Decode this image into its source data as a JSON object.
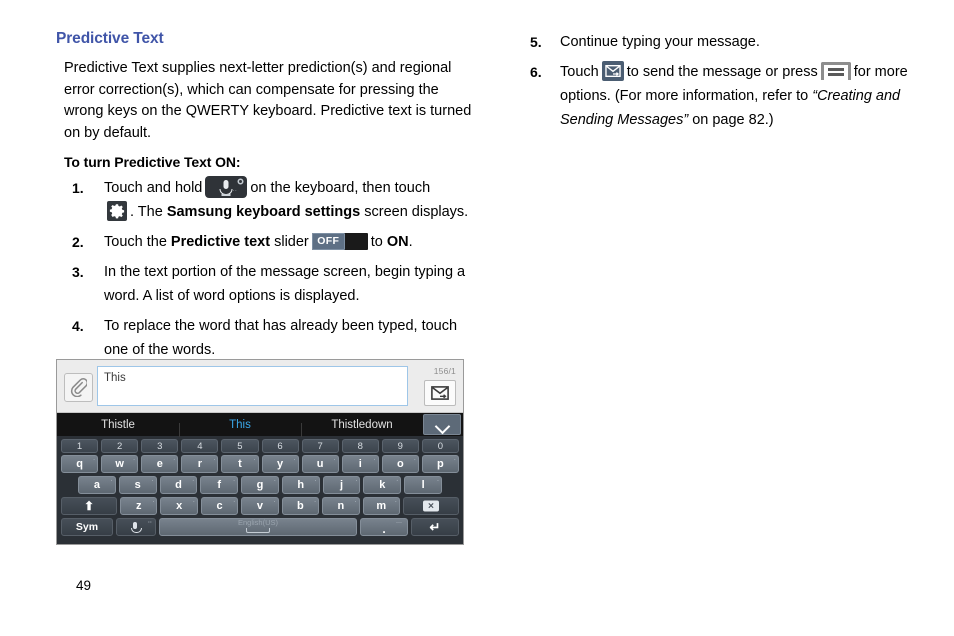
{
  "document": {
    "page_number": "49"
  },
  "left_column": {
    "section_title": "Predictive Text",
    "intro_paragraph": "Predictive Text supplies next-letter prediction(s) and regional error correction(s), which can compensate for pressing the wrong keys on the QWERTY keyboard. Predictive text is turned on by default.",
    "lead_in": "To turn Predictive Text ON:",
    "steps": [
      {
        "num": "1.",
        "part1": "Touch and hold",
        "icon1": "microphone-key-icon",
        "part2": "on the keyboard, then touch",
        "icon2": "gear-icon",
        "part3": ". The",
        "bold1": "Samsung keyboard settings",
        "part4": "screen displays."
      },
      {
        "num": "2.",
        "part1": "Touch the",
        "bold1": "Predictive text",
        "part2": "slider",
        "icon1": "off-slider-toggle",
        "slider_label": "OFF",
        "part3": "to",
        "bold2": "ON",
        "part4": "."
      },
      {
        "num": "3.",
        "text": "In the text portion of the message screen, begin typing a word. A list of word options is displayed."
      },
      {
        "num": "4.",
        "text": "To replace the word that has already been typed, touch one of the words."
      }
    ]
  },
  "right_column": {
    "steps": [
      {
        "num": "5.",
        "text": "Continue typing your message."
      },
      {
        "num": "6.",
        "part1": "Touch",
        "icon1": "send-message-icon",
        "part2": "to send the message or press",
        "icon2": "menu-key-icon",
        "part3": "for more options. (For more information, refer to",
        "italic_ref": "“Creating and Sending Messages”",
        "part4": "on page 82.)"
      }
    ]
  },
  "screenshot": {
    "compose": {
      "attach_icon": "paperclip-icon",
      "message_text": "This",
      "char_counter": "156/1",
      "send_icon": "send-envelope-icon"
    },
    "suggestions": {
      "items": [
        {
          "label": "Thistle",
          "active": false
        },
        {
          "label": "This",
          "active": true
        },
        {
          "label": "Thistledown",
          "active": false
        }
      ],
      "expand_icon": "chevron-down-icon"
    },
    "keyboard": {
      "number_row": [
        "1",
        "2",
        "3",
        "4",
        "5",
        "6",
        "7",
        "8",
        "9",
        "0"
      ],
      "row1": [
        {
          "key": "q",
          "alt": "·"
        },
        {
          "key": "w",
          "alt": "·"
        },
        {
          "key": "e",
          "alt": "·"
        },
        {
          "key": "r",
          "alt": "·"
        },
        {
          "key": "t",
          "alt": "·"
        },
        {
          "key": "y",
          "alt": "·"
        },
        {
          "key": "u",
          "alt": "·"
        },
        {
          "key": "i",
          "alt": "·"
        },
        {
          "key": "o",
          "alt": "·"
        },
        {
          "key": "p",
          "alt": "·"
        }
      ],
      "row2": [
        {
          "key": "a",
          "alt": "·"
        },
        {
          "key": "s",
          "alt": "·"
        },
        {
          "key": "d",
          "alt": "·"
        },
        {
          "key": "f",
          "alt": "·"
        },
        {
          "key": "g",
          "alt": "·"
        },
        {
          "key": "h",
          "alt": "·"
        },
        {
          "key": "j",
          "alt": "·"
        },
        {
          "key": "k",
          "alt": "·"
        },
        {
          "key": "l",
          "alt": "·"
        }
      ],
      "row3": [
        {
          "key": "z",
          "alt": "·"
        },
        {
          "key": "x",
          "alt": "·"
        },
        {
          "key": "c",
          "alt": "·"
        },
        {
          "key": "v",
          "alt": "·"
        },
        {
          "key": "b",
          "alt": "·"
        },
        {
          "key": "n",
          "alt": "·"
        },
        {
          "key": "m",
          "alt": "·"
        }
      ],
      "shift_icon": "shift-arrow-icon",
      "backspace_label": "⌦",
      "sym_label": "Sym",
      "mic_icon": "microphone-icon",
      "space_label": "English(US)",
      "period_label": ".",
      "enter_icon": "enter-return-icon"
    }
  },
  "colors": {
    "heading": "#4055a8",
    "suggestion_active": "#3ba7e8",
    "slider_knob": "#5e7085",
    "send_icon_bg": "#4b5d72",
    "keyboard_bg": "#2b3036"
  }
}
